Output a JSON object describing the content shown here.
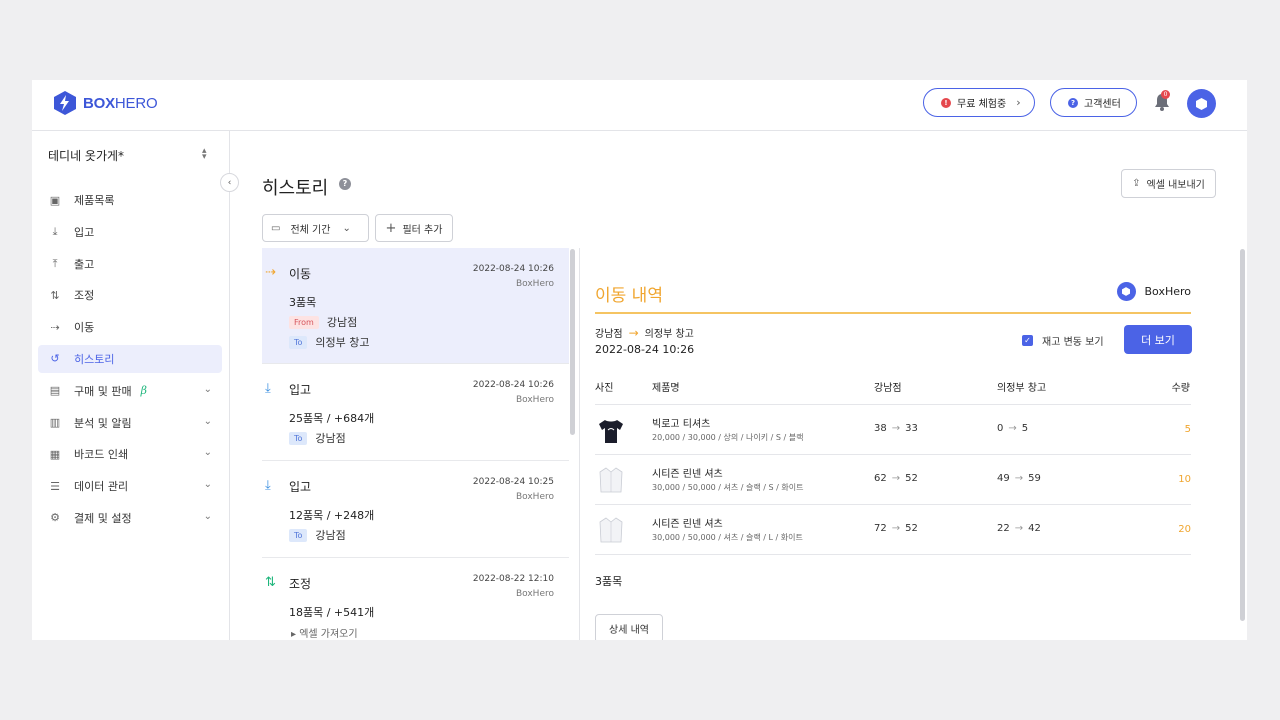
{
  "header": {
    "logo_bold": "BOX",
    "logo_light": "HERO",
    "trial_label": "무료 체험중",
    "support_label": "고객센터",
    "notification_count": "0"
  },
  "sidebar": {
    "store_name": "테디네 옷가게*",
    "items": [
      {
        "label": "제품목록",
        "icon": "box-icon"
      },
      {
        "label": "입고",
        "icon": "download-icon"
      },
      {
        "label": "출고",
        "icon": "upload-icon"
      },
      {
        "label": "조정",
        "icon": "adjust-icon"
      },
      {
        "label": "이동",
        "icon": "move-icon"
      },
      {
        "label": "히스토리",
        "icon": "history-icon",
        "active": true
      },
      {
        "label": "구매 및 판매",
        "icon": "document-icon",
        "beta": "β"
      },
      {
        "label": "분석 및 알림",
        "icon": "chart-icon"
      },
      {
        "label": "바코드 인쇄",
        "icon": "barcode-icon"
      },
      {
        "label": "데이터 관리",
        "icon": "database-icon"
      },
      {
        "label": "결제 및 설정",
        "icon": "gear-icon"
      }
    ]
  },
  "main": {
    "title": "히스토리",
    "export_label": "엑셀 내보내기",
    "period_label": "전체 기간",
    "filter_label": "필터 추가"
  },
  "history": [
    {
      "type": "이동",
      "date": "2022-08-24 10:26",
      "user": "BoxHero",
      "count": "3품목",
      "from_tag": "From",
      "from": "강남점",
      "to_tag": "To",
      "to": "의정부 창고"
    },
    {
      "type": "입고",
      "date": "2022-08-24 10:26",
      "user": "BoxHero",
      "count": "25품목 / +684개",
      "to_tag": "To",
      "to": "강남점"
    },
    {
      "type": "입고",
      "date": "2022-08-24 10:25",
      "user": "BoxHero",
      "count": "12품목 / +248개",
      "to_tag": "To",
      "to": "강남점"
    },
    {
      "type": "조정",
      "date": "2022-08-22 12:10",
      "user": "BoxHero",
      "count": "18품목 / +541개",
      "note": "엑셀 가져오기"
    }
  ],
  "detail": {
    "title": "이동 내역",
    "brand": "BoxHero",
    "from": "강남점",
    "to": "의정부 창고",
    "datetime": "2022-08-24 10:26",
    "show_stock_change": "재고 변동 보기",
    "more_label": "더 보기",
    "columns": {
      "photo": "사진",
      "name": "제품명",
      "from": "강남점",
      "to": "의정부 창고",
      "qty": "수량"
    },
    "rows": [
      {
        "name": "빅로고 티셔츠",
        "desc": "20,000 / 30,000 / 상의 / 나이키 / S / 블랙",
        "from_before": "38",
        "from_after": "33",
        "to_before": "0",
        "to_after": "5",
        "qty": "5",
        "thumb": "black-tshirt"
      },
      {
        "name": "시티즌 린넨 셔츠",
        "desc": "30,000 / 50,000 / 셔츠 / 슬랙 / S / 화이트",
        "from_before": "62",
        "from_after": "52",
        "to_before": "49",
        "to_after": "59",
        "qty": "10",
        "thumb": "white-shirt"
      },
      {
        "name": "시티즌 린넨 셔츠",
        "desc": "30,000 / 50,000 / 셔츠 / 슬랙 / L / 화이트",
        "from_before": "72",
        "from_after": "52",
        "to_before": "22",
        "to_after": "42",
        "qty": "20",
        "thumb": "white-shirt"
      }
    ],
    "total": "3품목",
    "detail_label": "상세 내역"
  },
  "colors": {
    "primary": "#4b63e6",
    "accent": "#f0a630",
    "danger": "#e5484d"
  }
}
